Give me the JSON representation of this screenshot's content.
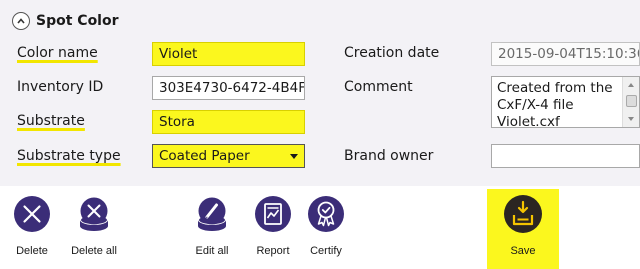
{
  "section": {
    "title": "Spot Color"
  },
  "fields": {
    "color_name": {
      "label": "Color name",
      "value": "Violet"
    },
    "inventory_id": {
      "label": "Inventory ID",
      "value": "303E4730-6472-4B4F-"
    },
    "substrate": {
      "label": "Substrate",
      "value": "Stora"
    },
    "substrate_type": {
      "label": "Substrate type",
      "value": "Coated Paper"
    },
    "creation_date": {
      "label": "Creation date",
      "value": "2015-09-04T15:10:36-"
    },
    "comment": {
      "label": "Comment",
      "value": "Created from the CxF/X-4 file Violet.cxf"
    },
    "brand_owner": {
      "label": "Brand owner",
      "value": ""
    }
  },
  "toolbar": {
    "delete": "Delete",
    "delete_all": "Delete all",
    "edit_all": "Edit all",
    "report": "Report",
    "certify": "Certify",
    "save": "Save"
  },
  "colors": {
    "accent": "#3b2d78",
    "highlight": "#fbf71e",
    "save_icon": "#2b2522"
  }
}
